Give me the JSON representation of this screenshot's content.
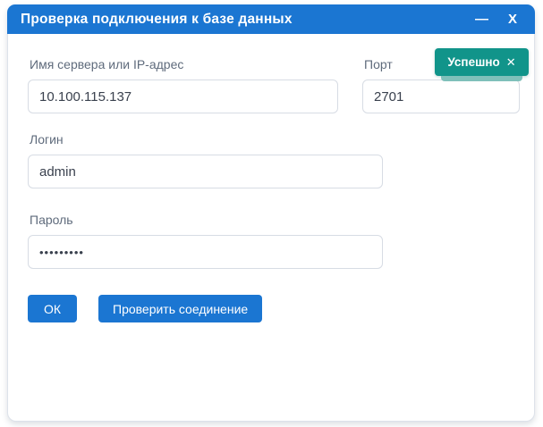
{
  "dialog": {
    "title": "Проверка подключения к базе данных",
    "minimize_label": "—",
    "close_label": "X"
  },
  "toast": {
    "label": "Успешно",
    "close_icon": "✕",
    "color": "#11948a"
  },
  "form": {
    "server": {
      "label": "Имя сервера или IP-адрес",
      "value": "10.100.115.137"
    },
    "port": {
      "label": "Порт",
      "value": "2701"
    },
    "login": {
      "label": "Логин",
      "value": "admin"
    },
    "password": {
      "label": "Пароль",
      "value": "•••••••••"
    }
  },
  "buttons": {
    "ok": "ОК",
    "check": "Проверить соединение"
  },
  "colors": {
    "accent": "#1b76d2",
    "success": "#11948a"
  }
}
